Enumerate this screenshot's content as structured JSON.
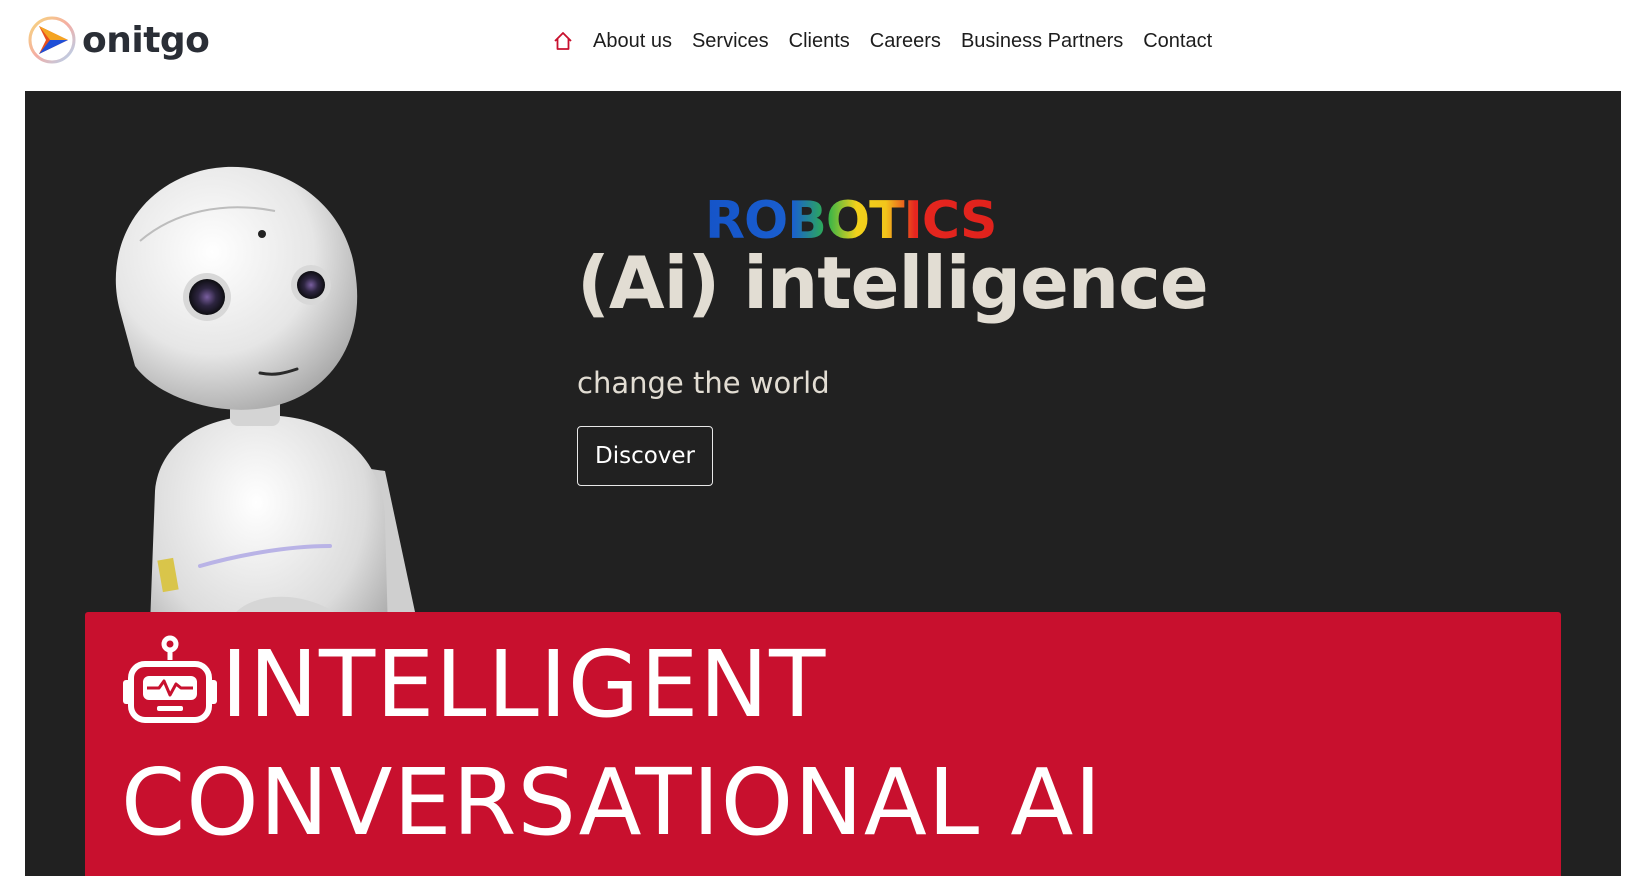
{
  "brand": {
    "name": "onitgo",
    "logo_icon": "play-triangle-ring-icon"
  },
  "nav": {
    "home_icon": "home-icon",
    "items": [
      "About us",
      "Services",
      "Clients",
      "Careers",
      "Business Partners",
      "Contact"
    ]
  },
  "hero": {
    "tag": "ROBOTICS",
    "title": "(Ai) intelligence",
    "subtitle": "change the world",
    "cta_label": "Discover",
    "image": "humanoid-robot-image"
  },
  "banner": {
    "icon": "chatbot-icon",
    "line1": "INTELLIGENT",
    "line2": "CONVERSATIONAL AI"
  },
  "colors": {
    "hero_bg": "#212121",
    "banner_bg": "#c8102e",
    "title_text": "#e2ddd3",
    "nav_home_icon": "#c8102e"
  }
}
